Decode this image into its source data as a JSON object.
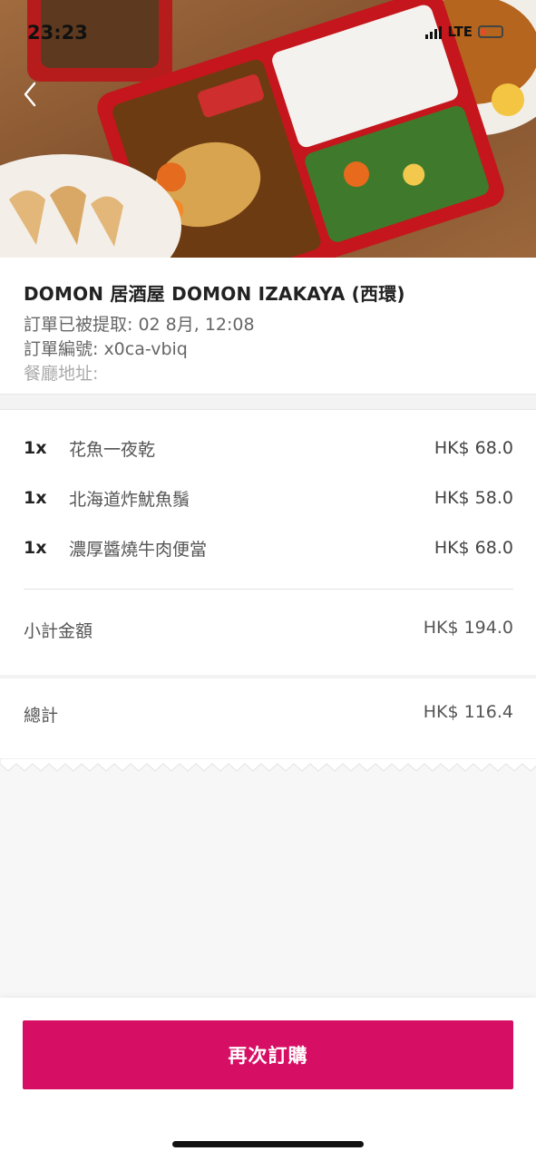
{
  "status_bar": {
    "time": "23:23",
    "network": "LTE"
  },
  "restaurant": {
    "name": "DOMON 居酒屋 DOMON IZAKAYA (西環)",
    "picked_up": "訂單已被提取: 02 8月, 12:08",
    "order_number": "訂單編號: x0ca-vbiq",
    "address_label": "餐廳地址:"
  },
  "items": [
    {
      "qty": "1x",
      "name": "花魚一夜乾",
      "price": "HK$ 68.0"
    },
    {
      "qty": "1x",
      "name": "北海道炸魷魚鬚",
      "price": "HK$ 58.0"
    },
    {
      "qty": "1x",
      "name": "濃厚醬燒牛肉便當",
      "price": "HK$ 68.0"
    }
  ],
  "subtotal": {
    "label": "小計金額",
    "value": "HK$ 194.0"
  },
  "total": {
    "label": "總計",
    "value": "HK$ 116.4"
  },
  "reorder_button": "再次訂購",
  "colors": {
    "brand": "#d70f64"
  },
  "icons": {
    "back": "chevron-left-icon",
    "signal": "signal-icon",
    "battery": "battery-icon"
  }
}
